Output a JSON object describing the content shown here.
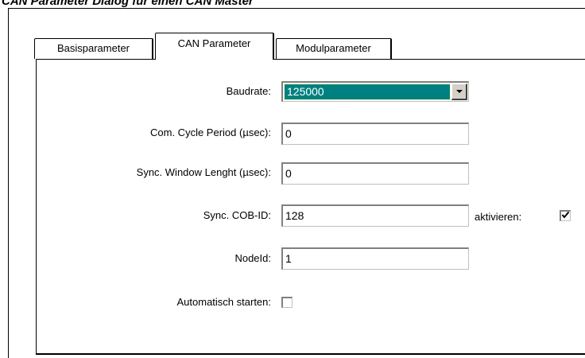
{
  "caption": "CAN Parameter Dialog für einen CAN Master",
  "tabs": {
    "basis": "Basisparameter",
    "can": "CAN Parameter",
    "modul": "Modulparameter"
  },
  "form": {
    "baudrate_label": "Baudrate:",
    "baudrate_value": "125000",
    "com_cycle_label": "Com. Cycle Period (µsec):",
    "com_cycle_value": "0",
    "sync_window_label": "Sync. Window Lenght (µsec):",
    "sync_window_value": "0",
    "sync_cob_label": "Sync. COB-ID:",
    "sync_cob_value": "128",
    "aktivieren_label": "aktivieren:",
    "aktivieren_checked": true,
    "nodeid_label": "NodeId:",
    "nodeid_value": "1",
    "auto_start_label": "Automatisch starten:",
    "auto_start_checked": false
  },
  "icons": {
    "dropdown": "chevron-down-icon",
    "check": "checkmark-icon"
  }
}
